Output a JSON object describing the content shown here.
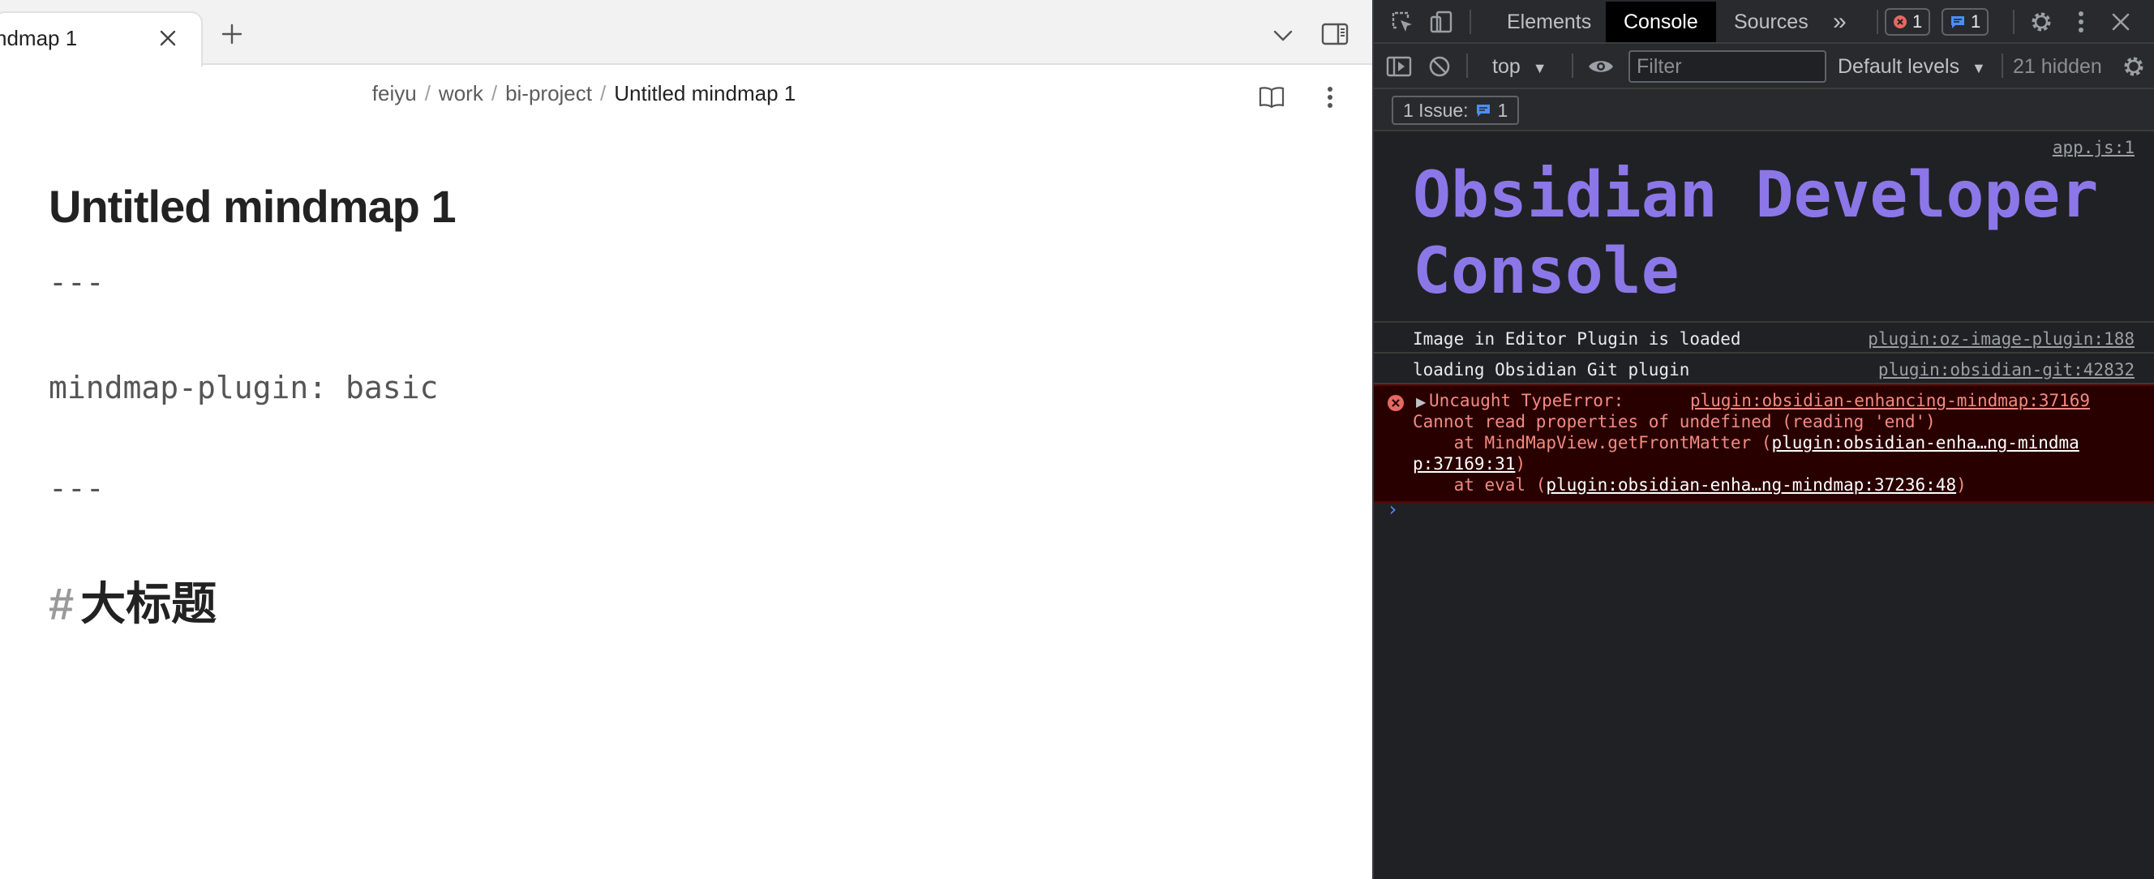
{
  "editor": {
    "tab_title": "ndmap 1",
    "breadcrumb": {
      "items": [
        "feiyu",
        "work",
        "bi-project"
      ],
      "separator": "/",
      "current": "Untitled mindmap 1"
    },
    "document": {
      "title": "Untitled mindmap 1",
      "frontmatter_open": "---",
      "frontmatter_line": "mindmap-plugin: basic",
      "frontmatter_close": "---",
      "heading_hash": "#",
      "heading_text": "大标题"
    }
  },
  "devtools": {
    "tabs": [
      "Elements",
      "Console",
      "Sources"
    ],
    "active_tab": "Console",
    "more_tabs_glyph": "»",
    "error_count": "1",
    "message_count": "1",
    "toolbar": {
      "context": "top",
      "filter_placeholder": "Filter",
      "levels": "Default levels",
      "hidden": "21 hidden"
    },
    "issues": {
      "label": "1 Issue:",
      "count": "1"
    },
    "console": {
      "banner_source": "app.js:1",
      "banner_text": "Obsidian Developer Console",
      "messages": [
        {
          "text": "Image in Editor Plugin is loaded",
          "source": "plugin:oz-image-plugin:188"
        },
        {
          "text": "loading Obsidian Git plugin",
          "source": "plugin:obsidian-git:42832"
        }
      ],
      "error": {
        "title": "Uncaught TypeError:",
        "source": "plugin:obsidian-enhancing-mindmap:37169",
        "message": "Cannot read properties of undefined (reading 'end')",
        "frame1_prefix": "    at MindMapView.getFrontMatter (",
        "frame1_link_a": "plugin:obsidian-enha…ng-mindma",
        "frame1_link_b": "p:37169:31",
        "frame1_suffix": ")",
        "frame2_prefix": "    at eval (",
        "frame2_link": "plugin:obsidian-enha…ng-mindmap:37236:48",
        "frame2_suffix": ")"
      },
      "prompt": "›"
    },
    "colors": {
      "banner": "#8c77e8",
      "error_bg": "#290000",
      "error_text": "#f28b82",
      "prompt": "#4c8df6"
    }
  }
}
